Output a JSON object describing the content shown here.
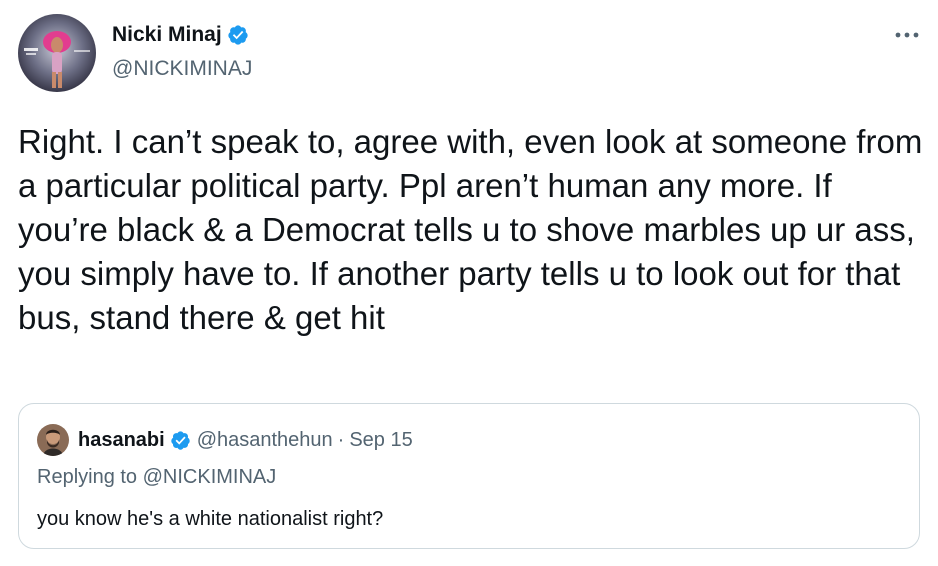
{
  "tweet": {
    "author": {
      "display_name": "Nicki Minaj",
      "handle": "@NICKIMINAJ",
      "verified": true,
      "verified_icon": "verified-badge-icon",
      "avatar_icon": "album-art-avatar"
    },
    "more_icon": "more-dots-icon",
    "text": "Right. I can’t speak to, agree with, even look at someone from a particular political party. Ppl aren’t human any more. If you’re black & a Democrat tells u to shove marbles up ur ass, you simply have to. If another party tells u to look out for that bus, stand there & get hit"
  },
  "quoted_tweet": {
    "author": {
      "display_name": "hasanabi",
      "handle": "@hasanthehun",
      "verified": true,
      "avatar_icon": "user-avatar"
    },
    "separator": "·",
    "date": "Sep 15",
    "replying_to": "Replying to @NICKIMINAJ",
    "text": "you know he's a white nationalist right?"
  },
  "colors": {
    "text_primary": "#0f1419",
    "text_secondary": "#536471",
    "verified_blue": "#1d9bf0",
    "border": "#cfd9de"
  }
}
